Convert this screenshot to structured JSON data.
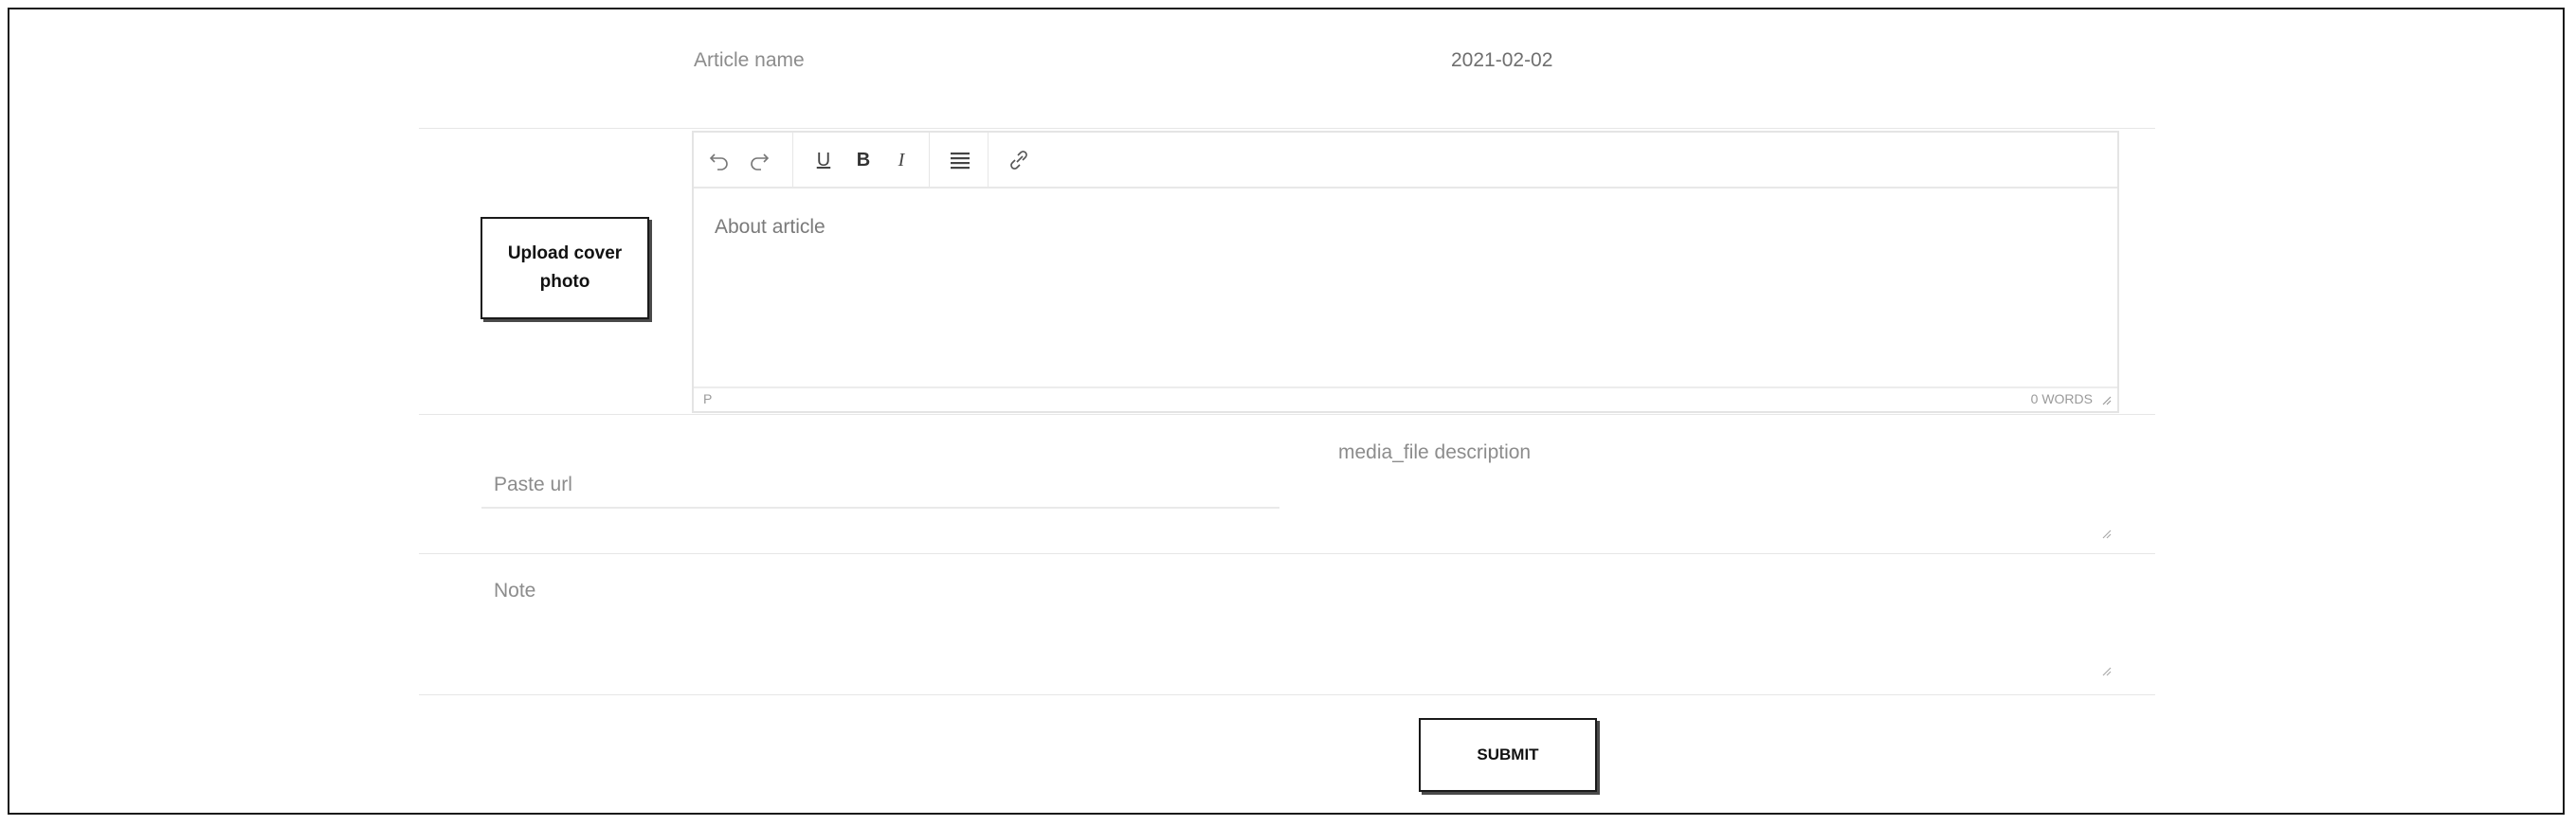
{
  "form": {
    "article_name_placeholder": "Article name",
    "date_value": "2021-02-02",
    "upload_cover_line1": "Upload cover",
    "upload_cover_line2": "photo",
    "editor": {
      "toolbar": [
        "undo-icon",
        "redo-icon",
        "underline-icon",
        "bold-icon",
        "italic-icon",
        "align-icon",
        "link-icon"
      ],
      "bold_glyph": "B",
      "italic_glyph": "I",
      "underline_glyph": "U",
      "placeholder": "About article",
      "status_path": "P",
      "word_count": "0 WORDS"
    },
    "paste_url_placeholder": "Paste url",
    "media_description_placeholder": "media_file description",
    "note_placeholder": "Note",
    "submit_label": "SUBMIT"
  }
}
